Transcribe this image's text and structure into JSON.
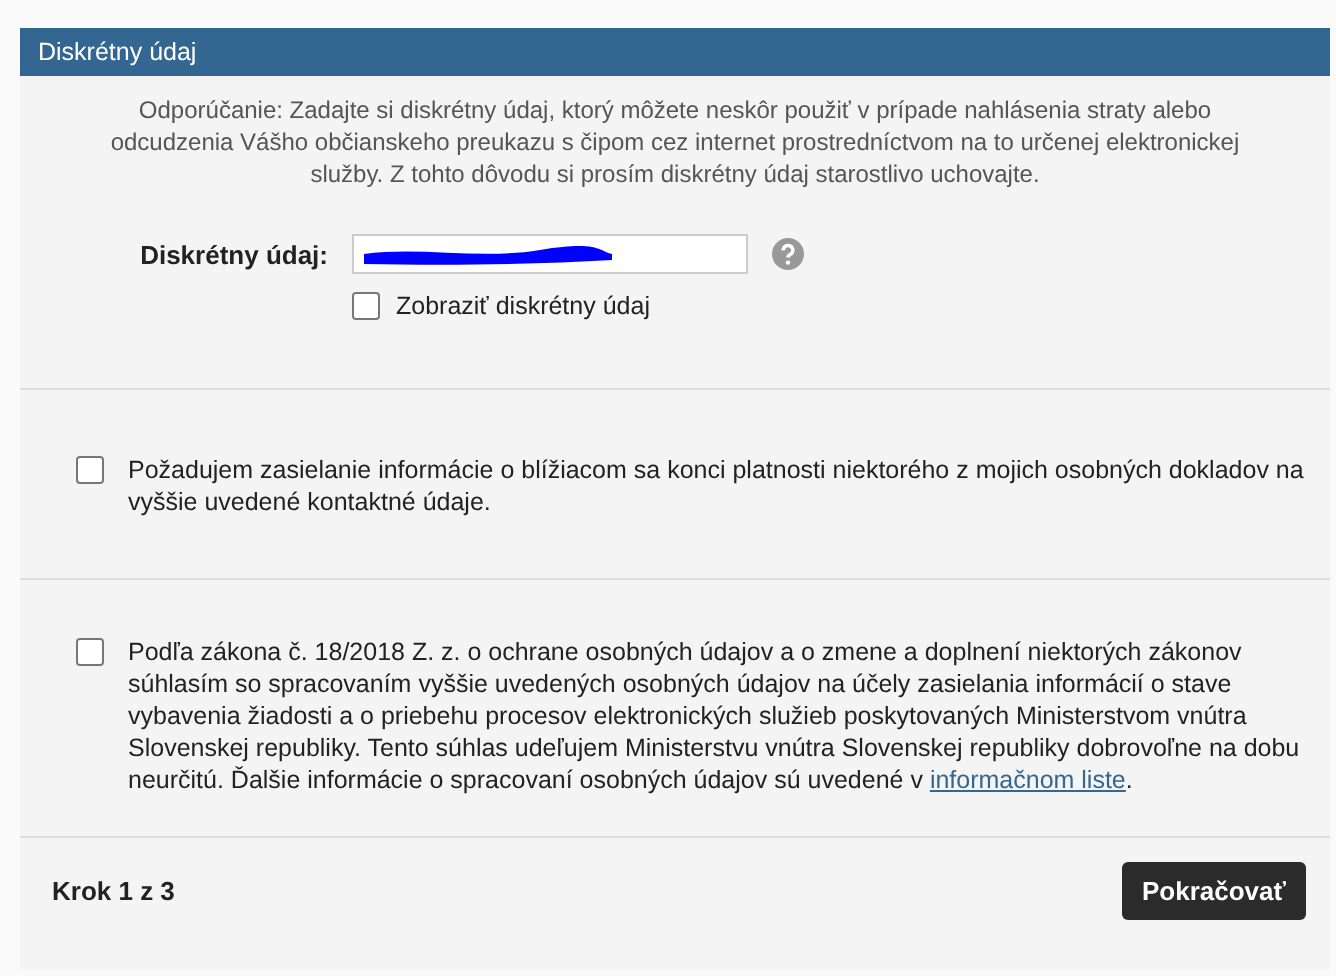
{
  "panel": {
    "title": "Diskrétny údaj"
  },
  "recommendation": "Odporúčanie: Zadajte si diskrétny údaj, ktorý môžete neskôr použiť v prípade nahlásenia straty alebo odcudzenia Vášho občianskeho preukazu s čipom cez internet prostredníctvom na to určenej elektronickej služby. Z tohto dôvodu si prosím diskrétny údaj starostlivo uchovajte.",
  "field": {
    "label": "Diskrétny údaj:",
    "show_option": {
      "label": "Zobraziť diskrétny údaj",
      "checked": false
    }
  },
  "consents": [
    {
      "text": "Požadujem zasielanie informácie o blížiacom sa konci platnosti niektorého z mojich osobných dokladov na vyššie uvedené kontaktné údaje.",
      "checked": false
    },
    {
      "text": "Podľa zákona č. 18/2018 Z. z. o ochrane osobných údajov a o zmene a doplnení niektorých zákonov súhlasím so spracovaním vyššie uvedených osobných údajov na účely zasielania informácií o stave vybavenia žiadosti a o priebehu procesov elektronických služieb poskytovaných Ministerstvom vnútra Slovenskej republiky. Tento súhlas udeľujem Ministerstvu vnútra Slovenskej republiky dobrovoľne na dobu neurčitú. Ďalšie informácie o spracovaní osobných údajov sú uvedené v",
      "link": "informačnom liste",
      "text_after": ".",
      "checked": false
    }
  ],
  "footer": {
    "step": "Krok 1 z 3",
    "continue_button": "Pokračovať"
  }
}
